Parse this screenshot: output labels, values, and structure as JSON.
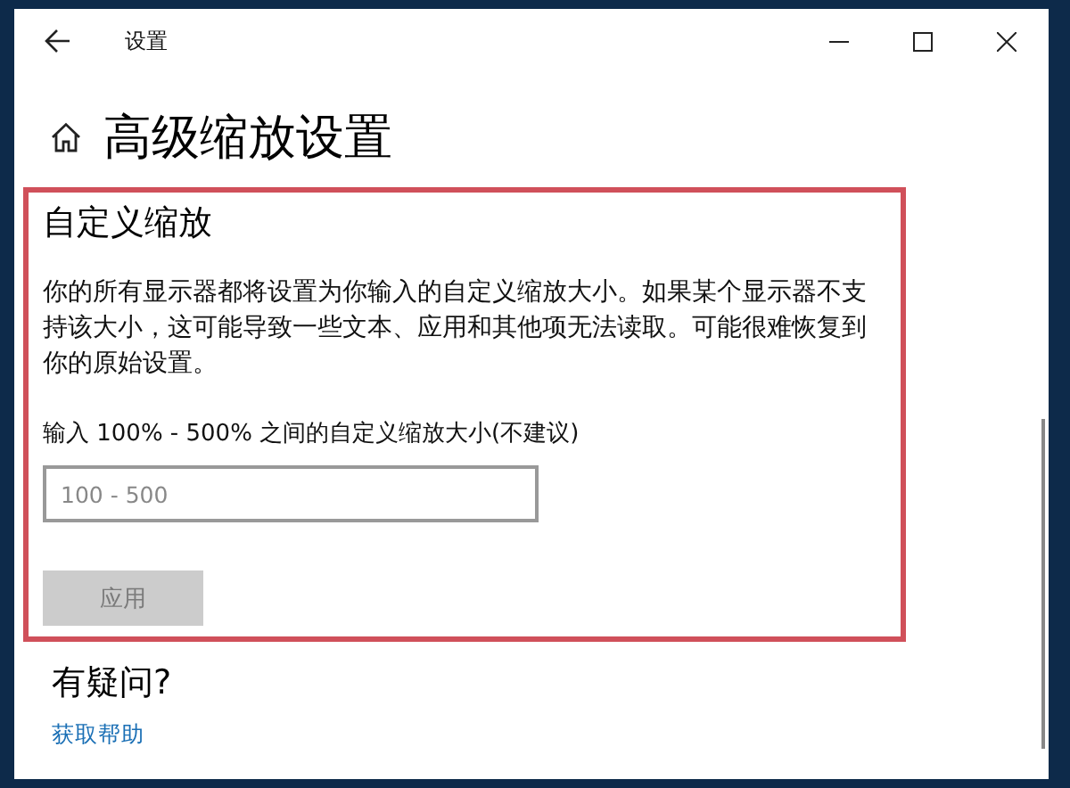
{
  "window": {
    "title": "设置"
  },
  "page_title": "高级缩放设置",
  "custom_scaling": {
    "heading": "自定义缩放",
    "description": "你的所有显示器都将设置为你输入的自定义缩放大小。如果某个显示器不支持该大小，这可能导致一些文本、应用和其他项无法读取。可能很难恢复到你的原始设置。",
    "field_label": "输入 100% - 500% 之间的自定义缩放大小(不建议)",
    "input": {
      "placeholder": "100 - 500"
    },
    "apply_button": {
      "label": "应用",
      "disabled": true
    }
  },
  "help": {
    "heading": "有疑问?",
    "link": "获取帮助"
  }
}
